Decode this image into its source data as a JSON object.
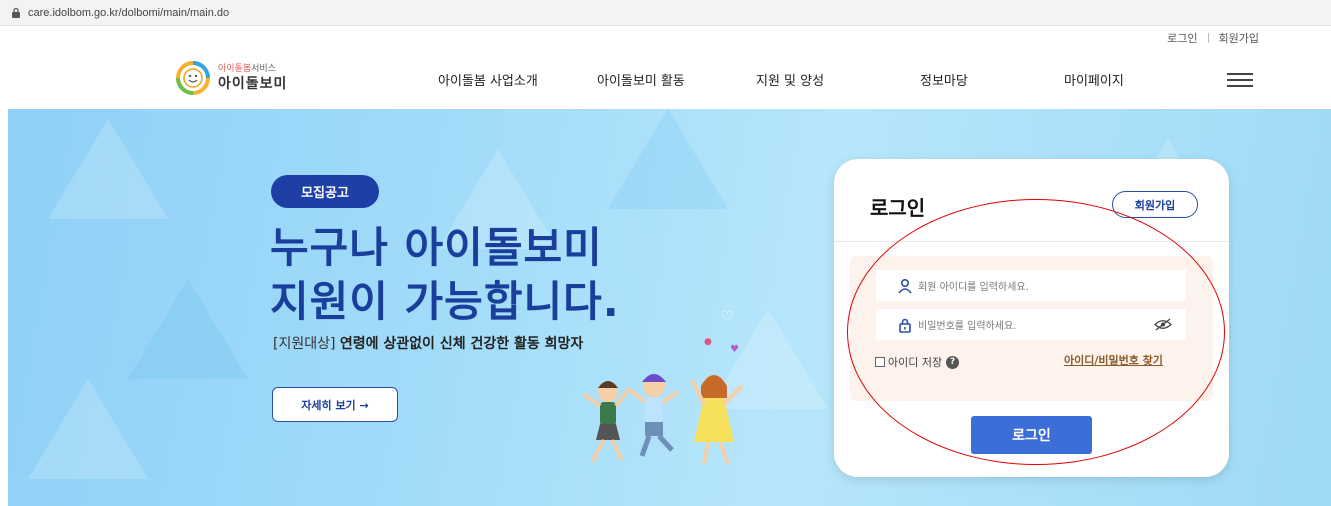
{
  "browser": {
    "url": "care.idolbom.go.kr/dolbomi/main/main.do"
  },
  "utility": {
    "login": "로그인",
    "signup": "회원가입"
  },
  "header": {
    "logo_top": "아이돌봄",
    "logo_top_suffix": "서비스",
    "logo_main": "아이돌보미",
    "menu": [
      "아이돌봄 사업소개",
      "아이돌보미 활동",
      "지원 및 양성",
      "정보마당",
      "마이페이지"
    ]
  },
  "hero": {
    "badge": "모집공고",
    "headline_1": "누구나 아이돌보미",
    "headline_2": "지원이 가능합니다.",
    "target_prefix": "[지원대상]",
    "target_text": "연령에 상관없이 신체 건강한 활동 희망자",
    "more_button": "자세히 보기  →"
  },
  "login": {
    "title": "로그인",
    "join_button": "회원가입",
    "id_placeholder": "회원 아이디를 입력하세요.",
    "pw_placeholder": "비밀번호를 입력하세요.",
    "remember_label": "아이디 저장",
    "help_glyph": "?",
    "find_link": "아이디/비밀번호 찾기",
    "submit": "로그인"
  },
  "colors": {
    "accent": "#1d3fa6",
    "button": "#3d6ed8",
    "annotation": "#e00000"
  },
  "icons": [
    "lock-icon",
    "smile-logo-icon",
    "hamburger-icon",
    "user-icon",
    "padlock-icon",
    "eye-slash-icon",
    "help-icon",
    "heart-icon"
  ]
}
